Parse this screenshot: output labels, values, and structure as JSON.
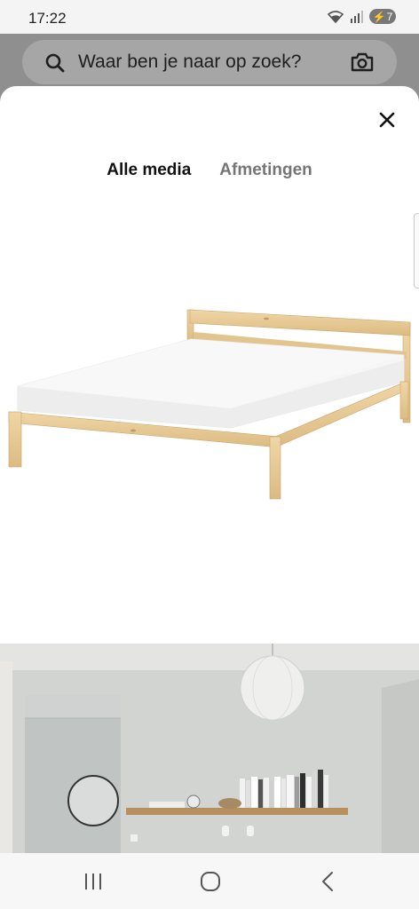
{
  "status_bar": {
    "time": "17:22",
    "battery_level": "7",
    "icons": [
      "wifi-icon",
      "signal-icon",
      "battery-charging-icon"
    ]
  },
  "search": {
    "placeholder": "Waar ben je naar op zoek?",
    "icons": [
      "search-icon",
      "camera-icon"
    ]
  },
  "media_sheet": {
    "close_icon": "close-icon",
    "tabs": [
      {
        "label": "Alle media",
        "active": true
      },
      {
        "label": "Afmetingen",
        "active": false
      }
    ],
    "images": [
      "bed-frame-product-image",
      "bedroom-room-image"
    ]
  },
  "nav_bar": {
    "buttons": [
      "recent-apps-icon",
      "home-icon",
      "back-icon"
    ]
  },
  "colors": {
    "accent_text": "#111111",
    "inactive_tab": "#757575",
    "wood": "#e8cc98",
    "mattress": "#f6f6f6",
    "overlay": "#8f8f8f"
  }
}
